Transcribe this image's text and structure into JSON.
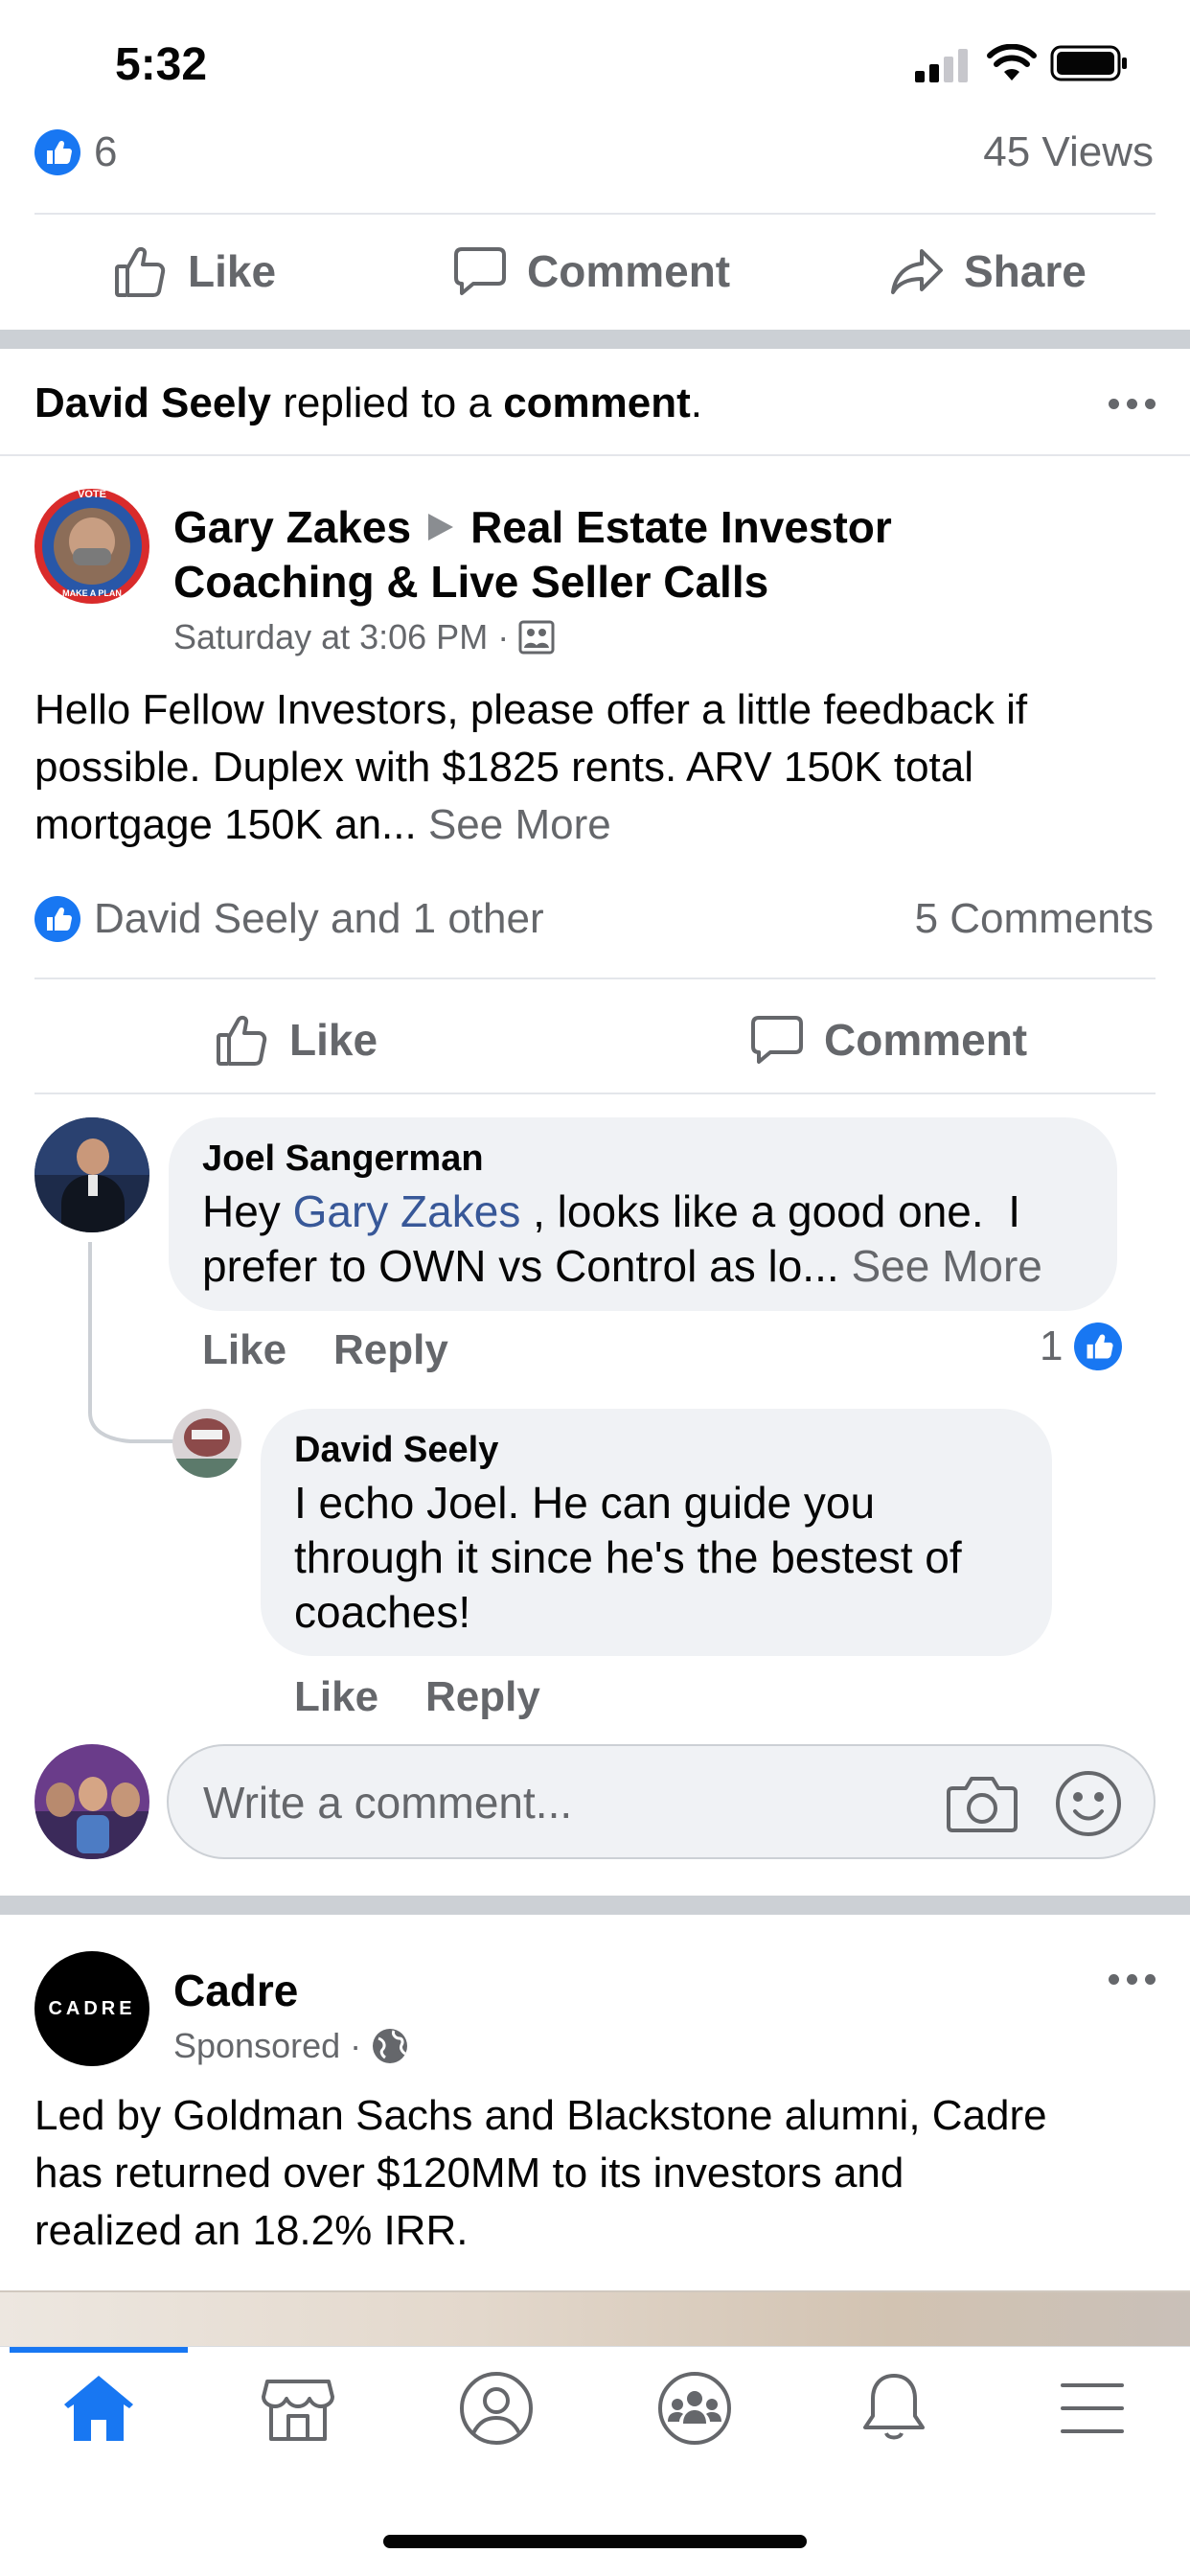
{
  "status_bar": {
    "time": "5:32"
  },
  "top_post": {
    "like_count": "6",
    "views": "45 Views",
    "actions": {
      "like": "Like",
      "comment": "Comment",
      "share": "Share"
    }
  },
  "notification": {
    "actor": "David Seely",
    "middle": " replied to a ",
    "object": "comment",
    "end": "."
  },
  "post": {
    "author": "Gary Zakes",
    "group_line1": "Real Estate Investor",
    "group_line2": "Coaching & Live Seller Calls",
    "timestamp": "Saturday at 3:06 PM",
    "separator": " · ",
    "body": "Hello Fellow Investors, please offer a little feedback if possible. Duplex with $1825 rents. ARV 150K total mortgage 150K an...",
    "see_more": "See More",
    "reactions": "David Seely and 1 other",
    "comments_count": "5 Comments",
    "actions": {
      "like": "Like",
      "comment": "Comment"
    },
    "avatar_badge_top": "VOTE",
    "avatar_badge_bottom": "MAKE A PLAN"
  },
  "comments": [
    {
      "author": "Joel Sangerman",
      "prefix": "Hey ",
      "mention": "Gary Zakes",
      "text_line1_rest": " , looks like a good one.  I",
      "text_line2": "prefer to OWN vs Control as lo...",
      "see_more": "See More",
      "like": "Like",
      "reply": "Reply",
      "reaction_count": "1"
    },
    {
      "author": "David Seely",
      "lines": [
        "I echo Joel.  He can guide you",
        "through it since he's the bestest of",
        "coaches!"
      ],
      "like": "Like",
      "reply": "Reply"
    }
  ],
  "composer": {
    "placeholder": "Write a comment..."
  },
  "ad": {
    "name": "Cadre",
    "logo_text": "CADRE",
    "sponsored": "Sponsored",
    "separator": " · ",
    "body_lines": [
      "Led by Goldman Sachs and Blackstone alumni, Cadre",
      "has returned over $120MM to its investors and",
      "realized an 18.2% IRR."
    ]
  },
  "bottom_nav": {
    "items": [
      "home-icon",
      "marketplace-icon",
      "profile-icon",
      "groups-icon",
      "notifications-icon",
      "menu-icon"
    ],
    "active_index": 0
  },
  "colors": {
    "accent": "#1877f2",
    "link": "#385898",
    "text": "#050505",
    "secondary": "#65676b"
  }
}
